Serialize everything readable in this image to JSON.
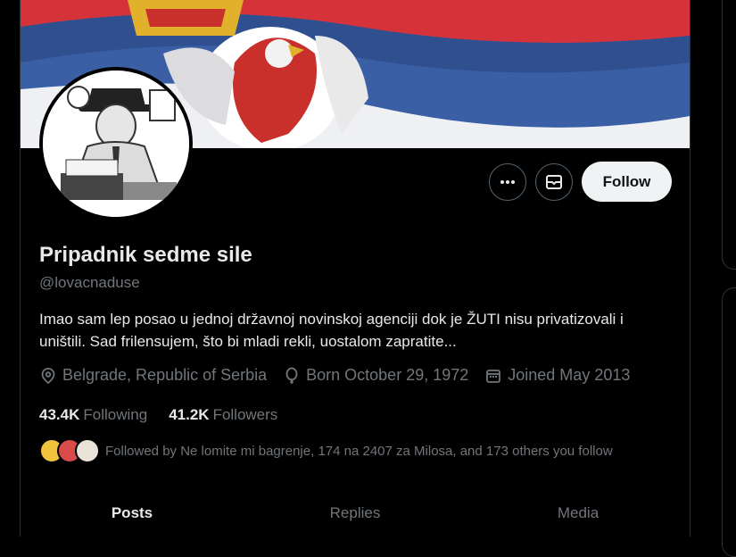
{
  "profile": {
    "name": "Pripadnik sedme sile",
    "handle": "@lovacnaduse",
    "bio": "Imao sam lep posao u jednoj državnoj novinskoj agenciji dok je ŽUTI nisu privatizovali i uništili. Sad frilensujem, što bi mladi rekli, uostalom zapratite...",
    "location": "Belgrade, Republic of Serbia",
    "born": "Born October 29, 1972",
    "joined": "Joined May 2013",
    "following_count": "43.4K",
    "following_label": "Following",
    "followers_count": "41.2K",
    "followers_label": "Followers",
    "followed_by": "Followed by Ne lomite mi bagrenje, 174 na 2407 za Milosa, and 173 others you follow"
  },
  "actions": {
    "more": "more-icon",
    "message": "message-icon",
    "follow": "Follow"
  },
  "tabs": [
    "Posts",
    "Replies",
    "Media"
  ],
  "colors": {
    "flag_red": "#c0392b",
    "flag_blue": "#2f4f8f",
    "flag_white": "#f2f2f2",
    "follow_bg": "#eff3f4"
  }
}
